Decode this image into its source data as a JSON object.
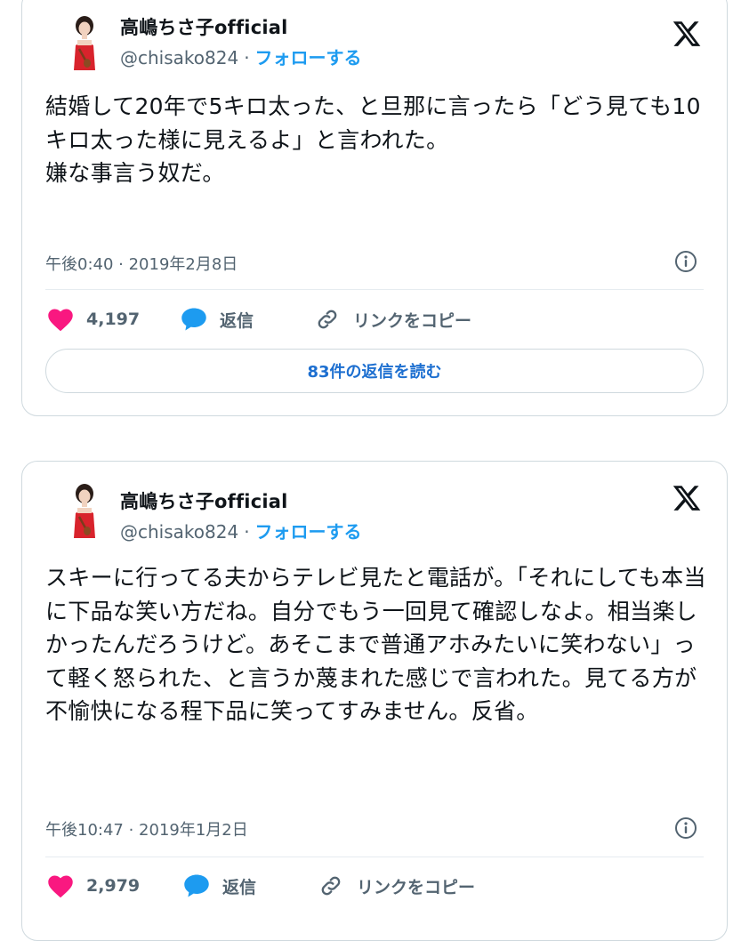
{
  "tweets": [
    {
      "author": "高嶋ちさ子official",
      "handle": "@chisako824",
      "separator": "·",
      "follow_label": "フォローする",
      "text": "結婚して20年で5キロ太った、と旦那に言ったら「どう見ても10キロ太った様に見えるよ」と言われた。\n嫌な事言う奴だ。",
      "timestamp": "午後0:40 · 2019年2月8日",
      "likes": "4,197",
      "reply_label": "返信",
      "copy_link_label": "リンクをコピー",
      "read_replies_label": "83件の返信を読む"
    },
    {
      "author": "高嶋ちさ子official",
      "handle": "@chisako824",
      "separator": "·",
      "follow_label": "フォローする",
      "text": "スキーに行ってる夫からテレビ見たと電話が。「それにしても本当に下品な笑い方だね。自分でもう一回見て確認しなよ。相当楽しかったんだろうけど。あそこまで普通アホみたいに笑わない」って軽く怒られた、と言うか蔑まれた感じで言われた。見てる方が不愉快になる程下品に笑ってすみません。反省。",
      "timestamp": "午後10:47 · 2019年1月2日",
      "likes": "2,979",
      "reply_label": "返信",
      "copy_link_label": "リンクをコピー"
    }
  ],
  "icons": {
    "x_logo": "x-logo-icon",
    "info": "info-icon",
    "like": "heart-icon",
    "reply": "speech-bubble-icon",
    "copy_link": "link-icon"
  },
  "colors": {
    "like": "#f91880",
    "reply": "#1d9bf0",
    "follow": "#1d9bf0",
    "link_button_text": "#1d6fd0",
    "muted": "#536471",
    "border": "#cfd9de"
  }
}
